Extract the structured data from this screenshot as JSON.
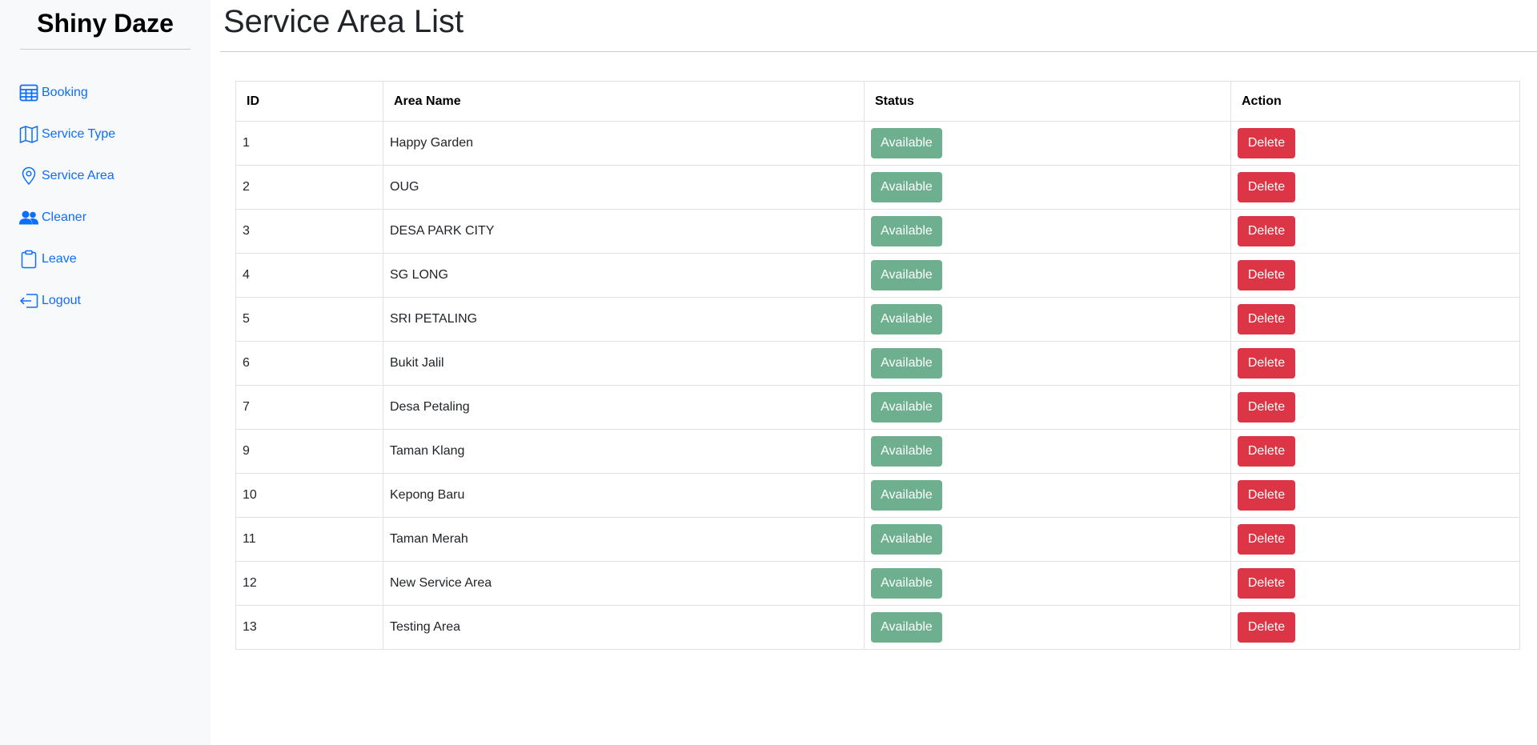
{
  "brand": "Shiny Daze",
  "nav": [
    {
      "label": "Booking",
      "icon": "table-icon"
    },
    {
      "label": "Service Type",
      "icon": "map-icon"
    },
    {
      "label": "Service Area",
      "icon": "map-pin-icon"
    },
    {
      "label": "Cleaner",
      "icon": "people-icon"
    },
    {
      "label": "Leave",
      "icon": "clipboard-icon"
    },
    {
      "label": "Logout",
      "icon": "logout-icon"
    }
  ],
  "colors": {
    "link": "#0d6efd",
    "available": "#6daf8e",
    "delete": "#dc3545",
    "sidebar_bg": "#f8f9fb"
  },
  "page": {
    "title": "Service Area List"
  },
  "table": {
    "headers": {
      "id": "ID",
      "name": "Area Name",
      "status": "Status",
      "action": "Action"
    },
    "rows": [
      {
        "id": "1",
        "name": "Happy Garden",
        "status": "Available",
        "action": "Delete"
      },
      {
        "id": "2",
        "name": "OUG",
        "status": "Available",
        "action": "Delete"
      },
      {
        "id": "3",
        "name": "DESA PARK CITY",
        "status": "Available",
        "action": "Delete"
      },
      {
        "id": "4",
        "name": "SG LONG",
        "status": "Available",
        "action": "Delete"
      },
      {
        "id": "5",
        "name": "SRI PETALING",
        "status": "Available",
        "action": "Delete"
      },
      {
        "id": "6",
        "name": "Bukit Jalil",
        "status": "Available",
        "action": "Delete"
      },
      {
        "id": "7",
        "name": "Desa Petaling",
        "status": "Available",
        "action": "Delete"
      },
      {
        "id": "9",
        "name": "Taman Klang",
        "status": "Available",
        "action": "Delete"
      },
      {
        "id": "10",
        "name": "Kepong Baru",
        "status": "Available",
        "action": "Delete"
      },
      {
        "id": "11",
        "name": "Taman Merah",
        "status": "Available",
        "action": "Delete"
      },
      {
        "id": "12",
        "name": "New Service Area",
        "status": "Available",
        "action": "Delete"
      },
      {
        "id": "13",
        "name": "Testing Area",
        "status": "Available",
        "action": "Delete"
      }
    ]
  }
}
